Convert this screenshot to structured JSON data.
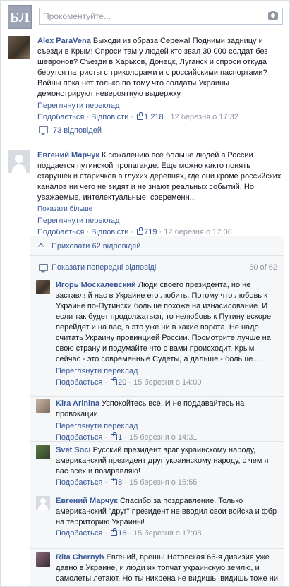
{
  "header": {
    "logo_text": "БЛ",
    "comment_placeholder": "Прокоментуйте...",
    "camera_icon": "camera-icon"
  },
  "ui": {
    "see_translation": "Переглянути переклад",
    "like": "Подобається",
    "reply": "Відповісти",
    "show_more": "Показати більше",
    "hide_replies": "Приховати 62 відповідей",
    "show_previous": "Показати попередні відповіді",
    "replies_counter": "50 of 62"
  },
  "comments": [
    {
      "author": "Alex ParaVena",
      "text": "Выходи из образа Сережа! Подними задницу и съезди в Крым! Спроси там у людей кто звал 30 000 солдат без шевронов? Съезди в Харьков, Донецк, Луганск и спроси откуда берутся патриоты с триколорами и с российскими паспортами? Войны пока нет только по тому что солдаты Украины демонстрируют невероятную выдержку.",
      "likes": "1 218",
      "time": "12 березня о 17:32",
      "replies_link": "73 відповідей"
    },
    {
      "author": "Евгений Марчук",
      "text": "К сожалению все больше людей в России поддается путинской пропаганде. Еще можно както понять старушек и старичков в глухих деревнях, где они кроме российских каналов ни чего не видят и не знают реальных событий. Но уважаемые, интелектуальные, современн...",
      "likes": "719",
      "time": "12 березня о 17:06"
    }
  ],
  "replies": [
    {
      "author": "Игорь Москалевский",
      "text": "Люди своего президента, но не заставляй нас в Украине его любить. Потому что любовь к Украине по-Путински больше похоже на изнасилование. И если так будет продолжаться, то нелюбовь к Путину вскоре перейдет и на вас, а это уже ни в какие ворота. Не надо считать Украину провинцией России. Посмотрите лучше на свою страну и подумайте что с вами происходит. Крым сейчас - это современные Судеты, а дальше - больше....",
      "likes": "20",
      "time": "15 березня о 14:00"
    },
    {
      "author": "Kira Arinina",
      "text": "Успокойтесь все. И не поддавайтесь на провокации.",
      "likes": "1",
      "time": "15 березня о 14:31"
    },
    {
      "author": "Svet Soci",
      "text": "Русский президент враг украинскому народу, американский президент друг украинскому народу, с чем я вас всех и поздравляю!",
      "likes": "8",
      "time": "15 березня о 15:55"
    },
    {
      "author": "Евгений Марчук",
      "text": "Спасибо за поздравление. Только американский \"друг\" президент не вводил свои войска и фбр на территорию Украины!",
      "likes": "16",
      "time": "15 березня о 17:08"
    },
    {
      "author": "Rita Chernyh",
      "text": "Евгений, врешь! Натовская 66-я дивизия уже давно в Украине, и люди их топчат украинскую землю, и самолеты летают. Но ты нихрена не видишь, видишь тоже ни путинских \"зеленых\""
    }
  ]
}
